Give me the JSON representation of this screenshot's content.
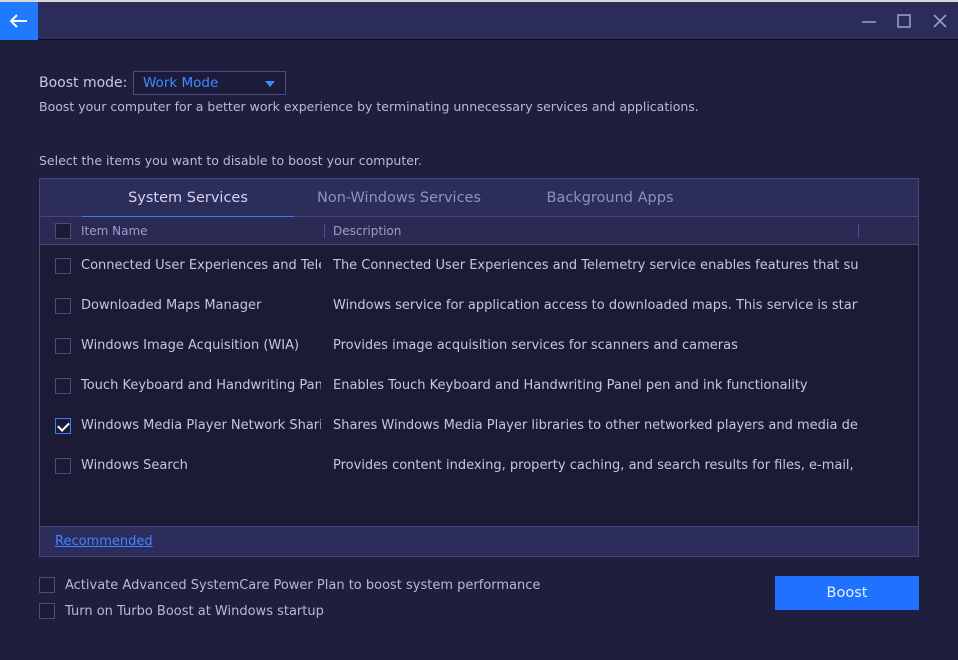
{
  "window": {
    "back_icon": "arrow-left-icon",
    "controls": [
      "minimize-icon",
      "maximize-icon",
      "close-icon"
    ]
  },
  "boost_mode": {
    "label": "Boost mode:",
    "selected": "Work Mode",
    "description": "Boost your computer for a better work experience by terminating unnecessary services and applications."
  },
  "instruction": "Select the items you want to disable to boost your computer.",
  "tabs": [
    {
      "label": "System Services",
      "active": true
    },
    {
      "label": "Non-Windows Services",
      "active": false
    },
    {
      "label": "Background Apps",
      "active": false
    }
  ],
  "table": {
    "columns": [
      "Item Name",
      "Description"
    ],
    "select_all_checked": false,
    "rows": [
      {
        "name": "Connected User Experiences and Tele...",
        "description": "The Connected User Experiences and Telemetry service enables features that support in...",
        "checked": false
      },
      {
        "name": "Downloaded Maps Manager",
        "description": "Windows service for application access to downloaded maps. This service is started on...",
        "checked": false
      },
      {
        "name": "Windows Image Acquisition (WIA)",
        "description": "Provides image acquisition services for scanners and cameras",
        "checked": false
      },
      {
        "name": "Touch Keyboard and Handwriting Pane...",
        "description": "Enables Touch Keyboard and Handwriting Panel pen and ink functionality",
        "checked": false
      },
      {
        "name": "Windows Media Player Network Sharin...",
        "description": "Shares Windows Media Player libraries to other networked players and media devices ...",
        "checked": true
      },
      {
        "name": "Windows Search",
        "description": "Provides content indexing, property caching, and search results for files, e-mail, and ot...",
        "checked": false
      }
    ]
  },
  "recommended_link": "Recommended",
  "options": [
    {
      "label": "Activate Advanced SystemCare Power Plan to boost system performance",
      "checked": false
    },
    {
      "label": "Turn on Turbo Boost at Windows startup",
      "checked": false
    }
  ],
  "boost_button": "Boost",
  "colors": {
    "accent": "#1f72ff",
    "background": "#1f1f3d",
    "titlebar": "#2c2c5a"
  }
}
